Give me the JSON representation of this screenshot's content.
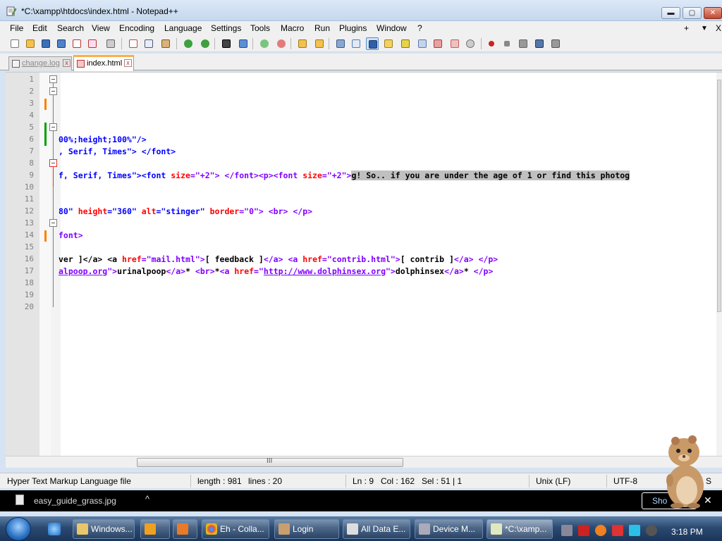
{
  "window": {
    "title": "*C:\\xampp\\htdocs\\index.html - Notepad++",
    "min_glyph": "▬",
    "max_glyph": "▢",
    "close_glyph": "✕"
  },
  "menu": {
    "items": [
      "File",
      "Edit",
      "Search",
      "View",
      "Encoding",
      "Language",
      "Settings",
      "Tools",
      "Macro",
      "Run",
      "Plugins",
      "Window",
      "?"
    ],
    "right": {
      "plus": "+",
      "down": "▼",
      "close": "X"
    }
  },
  "tabs": [
    {
      "label": "change.log",
      "active": false
    },
    {
      "label": "index.html",
      "active": true
    }
  ],
  "editor": {
    "line_numbers": [
      "1",
      "2",
      "3",
      "4",
      "5",
      "6",
      "7",
      "8",
      "9",
      "10",
      "11",
      "12",
      "13",
      "14",
      "15",
      "16",
      "17",
      "18",
      "19",
      "20"
    ],
    "lines": {
      "l6": {
        "a": "00%;height;100%\"/>"
      },
      "l7": {
        "a": ", Serif, Times\"> </font>"
      },
      "l9": {
        "a": "f, Serif, Times\"><font ",
        "b": "size",
        "c": "=\"+2\"> </font><p><font ",
        "d": "size",
        "e": "=\"+2\">",
        "sel": "g! So.. if you are under the age of 1 or find this photog"
      },
      "l12": {
        "a": "80\" ",
        "b": "height",
        "c": "=\"360\" ",
        "d": "alt",
        "e": "=\"stinger\" ",
        "f": "border",
        "g": "=\"0\"> <br> </p>"
      },
      "l14": {
        "a": "font>"
      },
      "l16": {
        "a": "ver ]</a> <a ",
        "b": "href",
        "c": "=\"mail.html\">",
        "d": "[ feedback ]",
        "e": "</a> <a ",
        "f": "href",
        "g": "=\"contrib.html\">",
        "h": "[ contrib ]",
        "i": "</a> </p>"
      },
      "l17": {
        "a": "alpoop.org",
        "b": "\">",
        "c": "urinalpoop",
        "d": "</a>",
        "e": "* ",
        "f": "<br>",
        "g": "*",
        "h": "<a ",
        "i": "href",
        "j": "=\"",
        "k": "http://www.dolphinsex.org",
        "l": "\">",
        "m": "dolphinsex",
        "n": "</a>",
        "o": "* ",
        "p": "</p>"
      }
    }
  },
  "hscroll": {
    "grip": "III"
  },
  "status": {
    "file_type": "Hyper Text Markup Language file",
    "length": "length : 981",
    "lines": "lines : 20",
    "ln": "Ln : 9",
    "col": "Col : 162",
    "sel": "Sel : 51 | 1",
    "eol": "Unix (LF)",
    "encoding": "UTF-8",
    "ins": "S"
  },
  "download": {
    "file_name": "easy_guide_grass.jpg",
    "caret": "^",
    "show_label": "Sho",
    "close": "✕"
  },
  "taskbar": {
    "buttons": [
      {
        "label": "Windows..."
      },
      {
        "label": ""
      },
      {
        "label": ""
      },
      {
        "label": "Eh - Colla..."
      },
      {
        "label": "Login"
      },
      {
        "label": "All Data E..."
      },
      {
        "label": "Device M..."
      },
      {
        "label": "*C:\\xamp..."
      }
    ],
    "clock": "3:18 PM"
  },
  "colors": {
    "tag": "#8000ff",
    "attribute": "#ff0000",
    "value": "#0000ff",
    "selection": "#c0c0c0",
    "fold_change": "#ff8000",
    "saved_change": "#00a000"
  }
}
